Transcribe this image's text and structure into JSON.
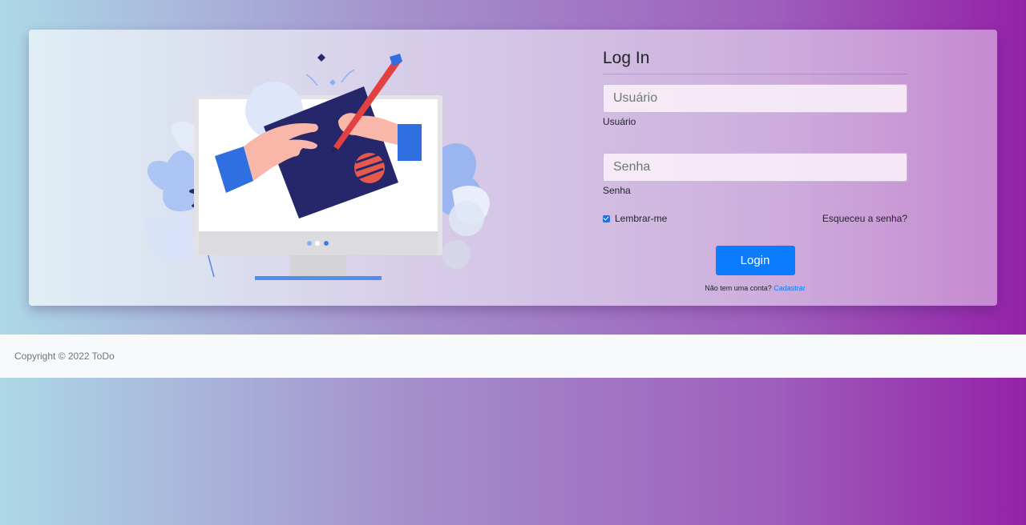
{
  "login": {
    "title": "Log In",
    "username": {
      "placeholder": "Usuário",
      "label": "Usuário",
      "value": ""
    },
    "password": {
      "placeholder": "Senha",
      "label": "Senha",
      "value": ""
    },
    "remember_label": "Lembrar-me",
    "remember_checked": true,
    "forgot_label": "Esqueceu a senha?",
    "submit_label": "Login",
    "signup_prompt": "Não tem uma conta?",
    "signup_link": "Cadastrar"
  },
  "footer": {
    "copyright": "Copyright © 2022 ToDo"
  },
  "colors": {
    "accent": "#0b7bff",
    "gradient_start": "#add8e6",
    "gradient_end": "#9422a8"
  },
  "illustration": {
    "icon": "computer-signing-document-icon"
  }
}
